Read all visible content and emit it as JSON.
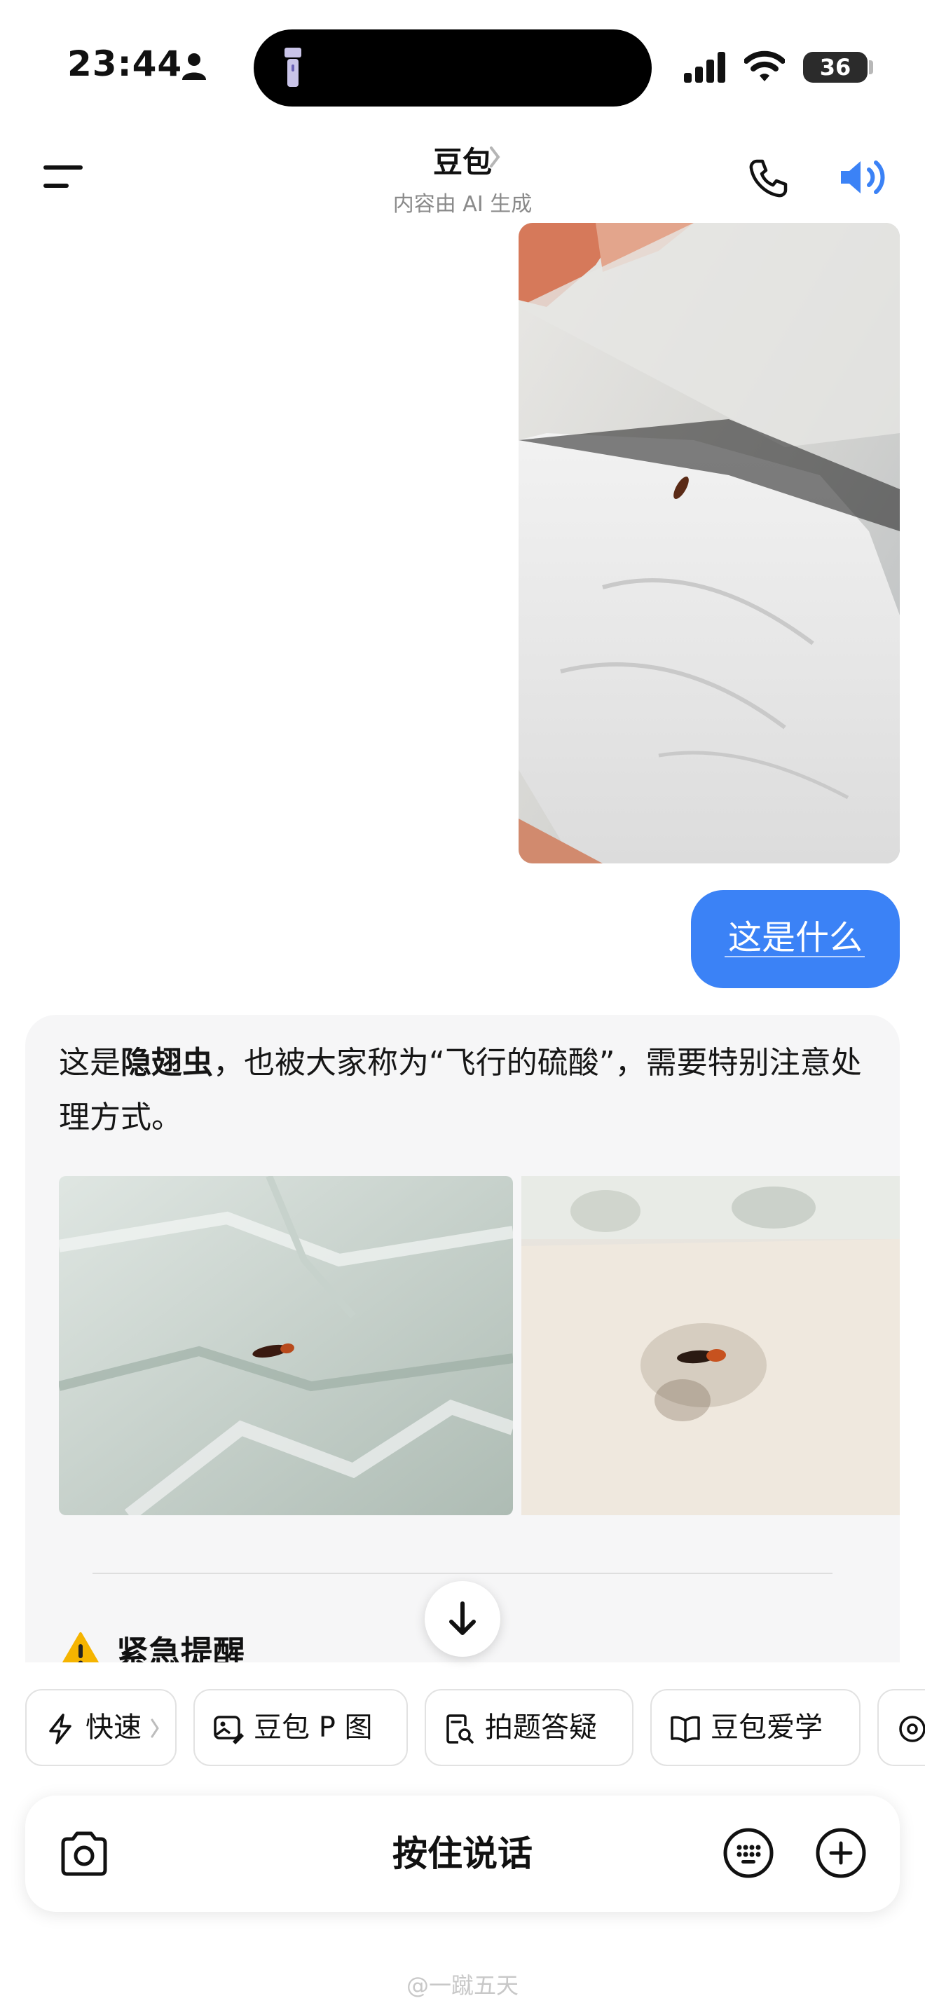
{
  "status_bar": {
    "time": "23:44",
    "battery": "36",
    "icons": [
      "person-icon",
      "flashlight-icon",
      "signal-icon",
      "wifi-icon",
      "battery-icon"
    ]
  },
  "header": {
    "title": "豆包",
    "subtitle": "内容由 AI 生成",
    "icons": [
      "menu-icon",
      "chevron-right-icon",
      "phone-icon",
      "speaker-icon"
    ]
  },
  "chat": {
    "user_message": "这是什么",
    "ai_reply": {
      "prefix": "这是",
      "bold": "隐翅虫",
      "suffix": "，也被大家称为“飞行的硫酸”，需要特别注意处理方式。",
      "section_title": "紧急提醒"
    }
  },
  "quick_actions": [
    {
      "label": "快速",
      "icon": "lightning-icon"
    },
    {
      "label": "豆包 P 图",
      "icon": "image-edit-icon"
    },
    {
      "label": "拍题答疑",
      "icon": "search-doc-icon"
    },
    {
      "label": "豆包爱学",
      "icon": "book-icon"
    }
  ],
  "input": {
    "hold_to_talk": "按住说话",
    "icons": [
      "camera-icon",
      "keyboard-icon",
      "plus-icon"
    ]
  },
  "watermark": "@一蹴五天",
  "colors": {
    "accent": "#3b82f6",
    "card_bg": "#f6f6f7",
    "warning": "#f5b400"
  }
}
